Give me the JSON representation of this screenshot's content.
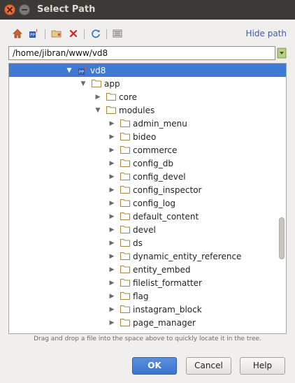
{
  "window": {
    "title": "Select Path"
  },
  "toolbar": {
    "icons": [
      "home-icon",
      "project-icon",
      "new-folder-icon",
      "delete-icon",
      "refresh-icon",
      "show-hidden-icon"
    ],
    "hide_path_label": "Hide path"
  },
  "path_field": {
    "value": "/home/jibran/www/vd8"
  },
  "tree": {
    "root": {
      "label": "vd8",
      "expanded": true,
      "selected": true
    },
    "app": {
      "label": "app",
      "expanded": true
    },
    "core": {
      "label": "core",
      "expanded": false
    },
    "modules_folder": {
      "label": "modules",
      "expanded": true
    },
    "modules": [
      "admin_menu",
      "bideo",
      "commerce",
      "config_db",
      "config_devel",
      "config_inspector",
      "config_log",
      "default_content",
      "devel",
      "ds",
      "dynamic_entity_reference",
      "entity_embed",
      "filelist_formatter",
      "flag",
      "instagram_block",
      "page_manager"
    ]
  },
  "hint": "Drag and drop a file into the space above to quickly locate it in the tree.",
  "buttons": {
    "ok": "OK",
    "cancel": "Cancel",
    "help": "Help"
  },
  "colors": {
    "selection": "#3d7ad6",
    "titlebar": "#3b3a36",
    "close": "#eb6b3a",
    "link": "#3d60a8",
    "folder": "#c4a76a"
  }
}
